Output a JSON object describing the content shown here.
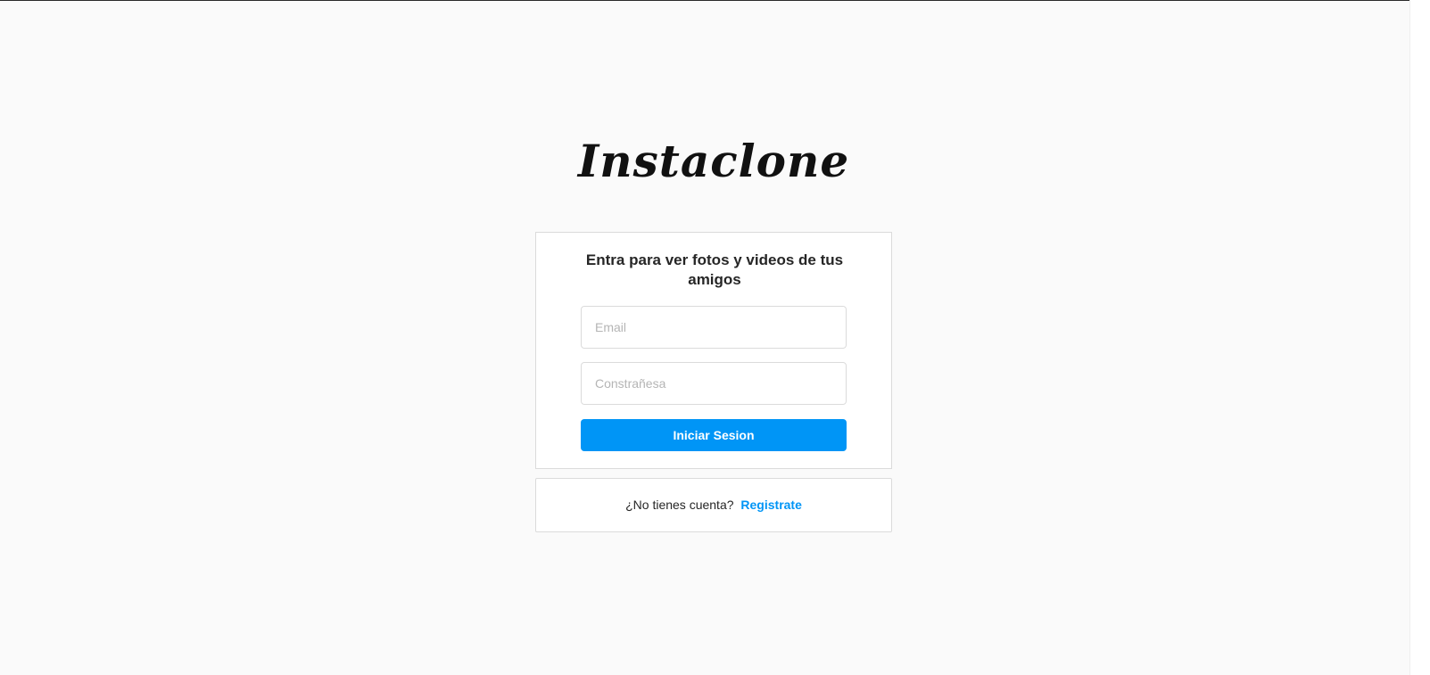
{
  "logo": {
    "text": "Instaclone"
  },
  "login": {
    "heading": "Entra para ver fotos y videos de tus amigos",
    "email_placeholder": "Email",
    "password_placeholder": "Constrañesa",
    "submit_label": "Iniciar Sesion"
  },
  "signup": {
    "prompt": "¿No tienes cuenta?",
    "link_label": "Registrate"
  },
  "colors": {
    "background": "#fafafa",
    "accent": "#0095f6",
    "border": "#dbdbdb",
    "text": "#262626"
  }
}
